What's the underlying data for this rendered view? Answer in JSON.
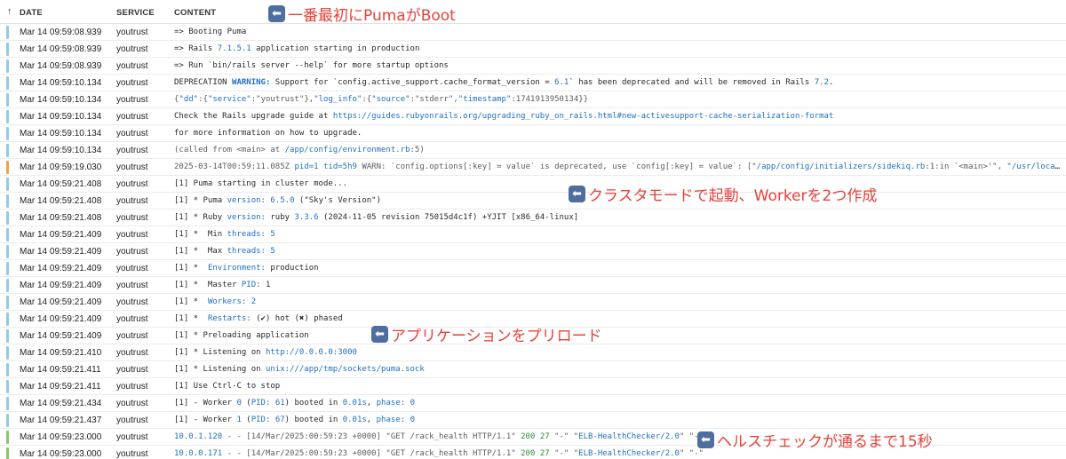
{
  "header": {
    "date": "DATE",
    "service": "SERVICE",
    "content": "CONTENT",
    "sort_icon": "arrow-up-icon"
  },
  "colors": {
    "info": "#8ecbe6",
    "warn": "#f2a340",
    "ok": "#86c96b",
    "annotation": "#e8413a",
    "link": "#1f6fc2"
  },
  "annotations": {
    "boot": "一番最初にPumaがBoot",
    "cluster": "クラスタモードで起動、Workerを2つ作成",
    "preload": "アプリケーションをプリロード",
    "health": "ヘルスチェックが通るまで15秒",
    "arrow_icon": "arrow-left-icon"
  },
  "rows": [
    {
      "level": "info",
      "date": "Mar 14 09:59:08.939",
      "service": "youtrust",
      "segs": [
        [
          "=> Booting Puma",
          ""
        ]
      ]
    },
    {
      "level": "info",
      "date": "Mar 14 09:59:08.939",
      "service": "youtrust",
      "segs": [
        [
          "=> Rails ",
          ""
        ],
        [
          "7.1.5.1",
          "hl"
        ],
        [
          " application starting in production",
          ""
        ]
      ]
    },
    {
      "level": "info",
      "date": "Mar 14 09:59:08.939",
      "service": "youtrust",
      "segs": [
        [
          "=> Run `bin/rails server --help` for more startup options",
          ""
        ]
      ]
    },
    {
      "level": "info",
      "date": "Mar 14 09:59:10.134",
      "service": "youtrust",
      "segs": [
        [
          "DEPRECATION ",
          ""
        ],
        [
          "WARNING:",
          "warn"
        ],
        [
          " Support for `config.active_support.cache_format_version = ",
          ""
        ],
        [
          "6.1",
          "hl"
        ],
        [
          "` has been deprecated and will be removed in Rails ",
          ""
        ],
        [
          "7.2",
          "hl"
        ],
        [
          ".",
          ""
        ]
      ]
    },
    {
      "level": "info",
      "date": "Mar 14 09:59:10.134",
      "service": "youtrust",
      "segs": [
        [
          "{",
          "gray"
        ],
        [
          "\"dd\"",
          "hl"
        ],
        [
          ":{",
          "gray"
        ],
        [
          "\"service\"",
          "hl"
        ],
        [
          ":\"youtrust\"},",
          "gray"
        ],
        [
          "\"log_info\"",
          "hl"
        ],
        [
          ":{",
          "gray"
        ],
        [
          "\"source\"",
          "hl"
        ],
        [
          ":\"stderr\",",
          "gray"
        ],
        [
          "\"timestamp\"",
          "hl"
        ],
        [
          ":1741913950134}}",
          "gray"
        ]
      ]
    },
    {
      "level": "info",
      "date": "Mar 14 09:59:10.134",
      "service": "youtrust",
      "segs": [
        [
          "Check the Rails upgrade guide at ",
          ""
        ],
        [
          "https://guides.rubyonrails.org/upgrading_ruby_on_rails.html#new-activesupport-cache-serialization-format",
          "hl"
        ]
      ]
    },
    {
      "level": "info",
      "date": "Mar 14 09:59:10.134",
      "service": "youtrust",
      "segs": [
        [
          "for more information on how to upgrade.",
          ""
        ]
      ]
    },
    {
      "level": "info",
      "date": "Mar 14 09:59:10.134",
      "service": "youtrust",
      "segs": [
        [
          "(called from <main> at ",
          "gray"
        ],
        [
          "/app/config/environment.rb",
          "hl"
        ],
        [
          ":5)",
          "gray"
        ]
      ]
    },
    {
      "level": "warn",
      "date": "Mar 14 09:59:19.030",
      "service": "youtrust",
      "segs": [
        [
          "2025-03-14T00:59:11.085Z ",
          "gray"
        ],
        [
          "pid=1 tid=5h9",
          "hl"
        ],
        [
          " WARN: `config.options[:key] = value` is deprecated, use `config[:key] = value`: [\"",
          "gray"
        ],
        [
          "/app/config/initializers/sidekiq.rb",
          "hl"
        ],
        [
          ":1:in `<main>'\", \"",
          "gray"
        ],
        [
          "/usr/local/bundle/…",
          "hl"
        ]
      ]
    },
    {
      "level": "info",
      "date": "Mar 14 09:59:21.408",
      "service": "youtrust",
      "segs": [
        [
          "[1] Puma starting in cluster mode...",
          ""
        ]
      ]
    },
    {
      "level": "info",
      "date": "Mar 14 09:59:21.408",
      "service": "youtrust",
      "segs": [
        [
          "[1] * Puma ",
          ""
        ],
        [
          "version:",
          "hl"
        ],
        [
          " ",
          ""
        ],
        [
          "6.5.0",
          "hl"
        ],
        [
          " (\"Sky's Version\")",
          ""
        ]
      ]
    },
    {
      "level": "info",
      "date": "Mar 14 09:59:21.408",
      "service": "youtrust",
      "segs": [
        [
          "[1] * Ruby ",
          ""
        ],
        [
          "version:",
          "hl"
        ],
        [
          " ruby ",
          ""
        ],
        [
          "3.3.6",
          "hl"
        ],
        [
          " (2024-11-05 revision 75015d4c1f) +YJIT [x86_64-linux]",
          ""
        ]
      ]
    },
    {
      "level": "info",
      "date": "Mar 14 09:59:21.409",
      "service": "youtrust",
      "segs": [
        [
          "[1] *  Min ",
          ""
        ],
        [
          "threads:",
          "hl"
        ],
        [
          " ",
          ""
        ],
        [
          "5",
          "hl"
        ]
      ]
    },
    {
      "level": "info",
      "date": "Mar 14 09:59:21.409",
      "service": "youtrust",
      "segs": [
        [
          "[1] *  Max ",
          ""
        ],
        [
          "threads:",
          "hl"
        ],
        [
          " ",
          ""
        ],
        [
          "5",
          "hl"
        ]
      ]
    },
    {
      "level": "info",
      "date": "Mar 14 09:59:21.409",
      "service": "youtrust",
      "segs": [
        [
          "[1] *  ",
          ""
        ],
        [
          "Environment:",
          "hl"
        ],
        [
          " production",
          ""
        ]
      ]
    },
    {
      "level": "info",
      "date": "Mar 14 09:59:21.409",
      "service": "youtrust",
      "segs": [
        [
          "[1] *  Master ",
          ""
        ],
        [
          "PID:",
          "hl"
        ],
        [
          " 1",
          ""
        ]
      ]
    },
    {
      "level": "info",
      "date": "Mar 14 09:59:21.409",
      "service": "youtrust",
      "segs": [
        [
          "[1] *  ",
          ""
        ],
        [
          "Workers:",
          "hl"
        ],
        [
          " ",
          ""
        ],
        [
          "2",
          "hl"
        ]
      ]
    },
    {
      "level": "info",
      "date": "Mar 14 09:59:21.409",
      "service": "youtrust",
      "segs": [
        [
          "[1] *  ",
          ""
        ],
        [
          "Restarts:",
          "hl"
        ],
        [
          " (✔) hot (✖) phased",
          ""
        ]
      ]
    },
    {
      "level": "info",
      "date": "Mar 14 09:59:21.409",
      "service": "youtrust",
      "segs": [
        [
          "[1] * Preloading application",
          ""
        ]
      ]
    },
    {
      "level": "info",
      "date": "Mar 14 09:59:21.410",
      "service": "youtrust",
      "segs": [
        [
          "[1] * Listening on ",
          ""
        ],
        [
          "http://0.0.0.0:3000",
          "hl"
        ]
      ]
    },
    {
      "level": "info",
      "date": "Mar 14 09:59:21.411",
      "service": "youtrust",
      "segs": [
        [
          "[1] * Listening on ",
          ""
        ],
        [
          "unix:///app/tmp/sockets/puma.sock",
          "hl"
        ]
      ]
    },
    {
      "level": "info",
      "date": "Mar 14 09:59:21.411",
      "service": "youtrust",
      "segs": [
        [
          "[1] Use Ctrl-C to stop",
          ""
        ]
      ]
    },
    {
      "level": "info",
      "date": "Mar 14 09:59:21.434",
      "service": "youtrust",
      "segs": [
        [
          "[1] - Worker ",
          ""
        ],
        [
          "0",
          "hl"
        ],
        [
          " (",
          ""
        ],
        [
          "PID:",
          "hl"
        ],
        [
          " ",
          ""
        ],
        [
          "61",
          "hl"
        ],
        [
          ") booted in ",
          ""
        ],
        [
          "0.01s",
          "hl"
        ],
        [
          ", ",
          ""
        ],
        [
          "phase:",
          "hl"
        ],
        [
          " ",
          ""
        ],
        [
          "0",
          "hl"
        ]
      ]
    },
    {
      "level": "info",
      "date": "Mar 14 09:59:21.437",
      "service": "youtrust",
      "segs": [
        [
          "[1] - Worker ",
          ""
        ],
        [
          "1",
          "hl"
        ],
        [
          " (",
          ""
        ],
        [
          "PID:",
          "hl"
        ],
        [
          " ",
          ""
        ],
        [
          "67",
          "hl"
        ],
        [
          ") booted in ",
          ""
        ],
        [
          "0.01s",
          "hl"
        ],
        [
          ", ",
          ""
        ],
        [
          "phase:",
          "hl"
        ],
        [
          " ",
          ""
        ],
        [
          "0",
          "hl"
        ]
      ]
    },
    {
      "level": "ok",
      "date": "Mar 14 09:59:23.000",
      "service": "youtrust",
      "segs": [
        [
          "10.0.1.120",
          "hl"
        ],
        [
          " - - [14/Mar/2025:00:59:23 +0000] \"GET /rack_health HTTP/1.1\" ",
          "gray"
        ],
        [
          "200 27",
          "gr"
        ],
        [
          " \"-\" \"",
          "gray"
        ],
        [
          "ELB-HealthChecker/2.0",
          "hl"
        ],
        [
          "\" \"-\"",
          "gray"
        ]
      ]
    },
    {
      "level": "ok",
      "date": "Mar 14 09:59:23.000",
      "service": "youtrust",
      "segs": [
        [
          "10.0.0.171",
          "hl"
        ],
        [
          " - - [14/Mar/2025:00:59:23 +0000] \"GET /rack_health HTTP/1.1\" ",
          "gray"
        ],
        [
          "200 27",
          "gr"
        ],
        [
          " \"-\" \"",
          "gray"
        ],
        [
          "ELB-HealthChecker/2.0",
          "hl"
        ],
        [
          "\" \"-\"",
          "gray"
        ]
      ]
    }
  ]
}
